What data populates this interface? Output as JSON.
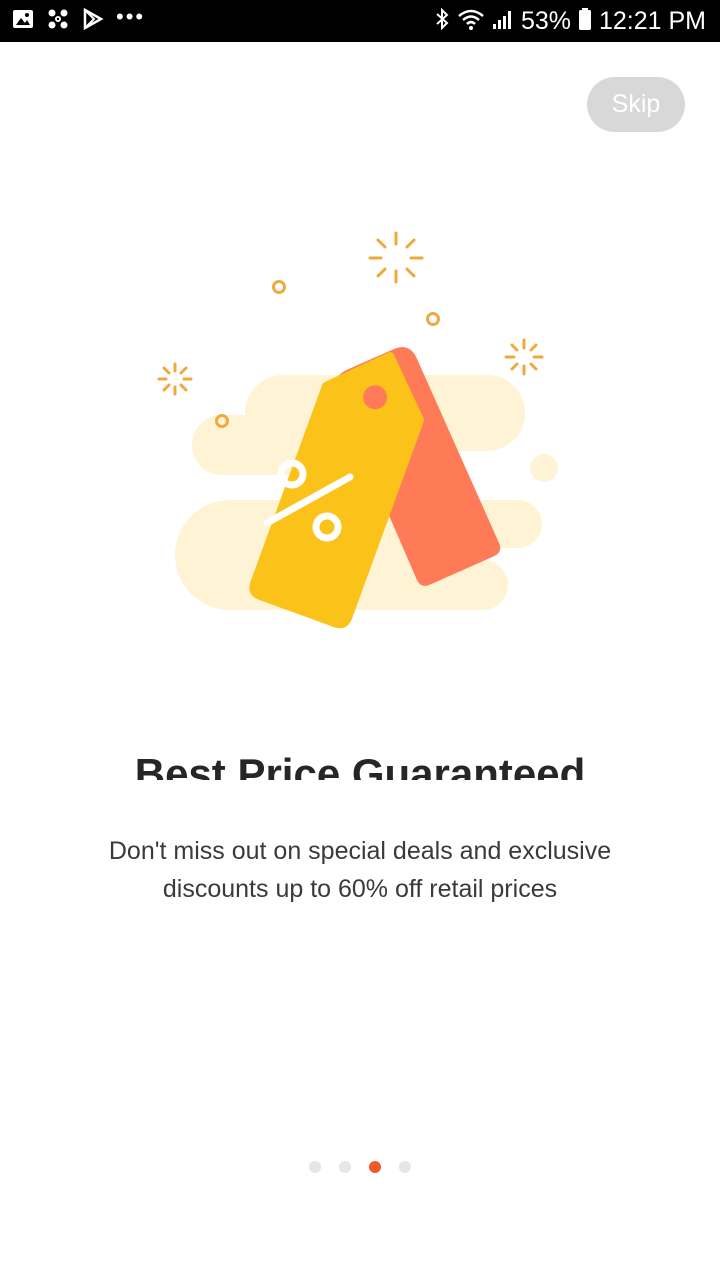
{
  "status_bar": {
    "battery": "53%",
    "time": "12:21 PM",
    "more": "•••"
  },
  "skip_label": "Skip",
  "title": "Best Price Guaranteed",
  "subtitle_line1": "Don't miss out on special deals and exclusive",
  "subtitle_line2": "discounts up to 60% off retail prices",
  "pager": {
    "total": 4,
    "active_index": 2
  },
  "colors": {
    "accent": "#ef5a2a",
    "tag_front": "#fbc21a",
    "tag_back": "#ff7b57",
    "cloud": "#fff3d6",
    "sparkle": "#f2a93b"
  },
  "icons": [
    "gallery-icon",
    "fan-icon",
    "play-store-icon",
    "bluetooth-icon",
    "wifi-icon",
    "signal-icon",
    "battery-icon",
    "price-tag-icon"
  ]
}
